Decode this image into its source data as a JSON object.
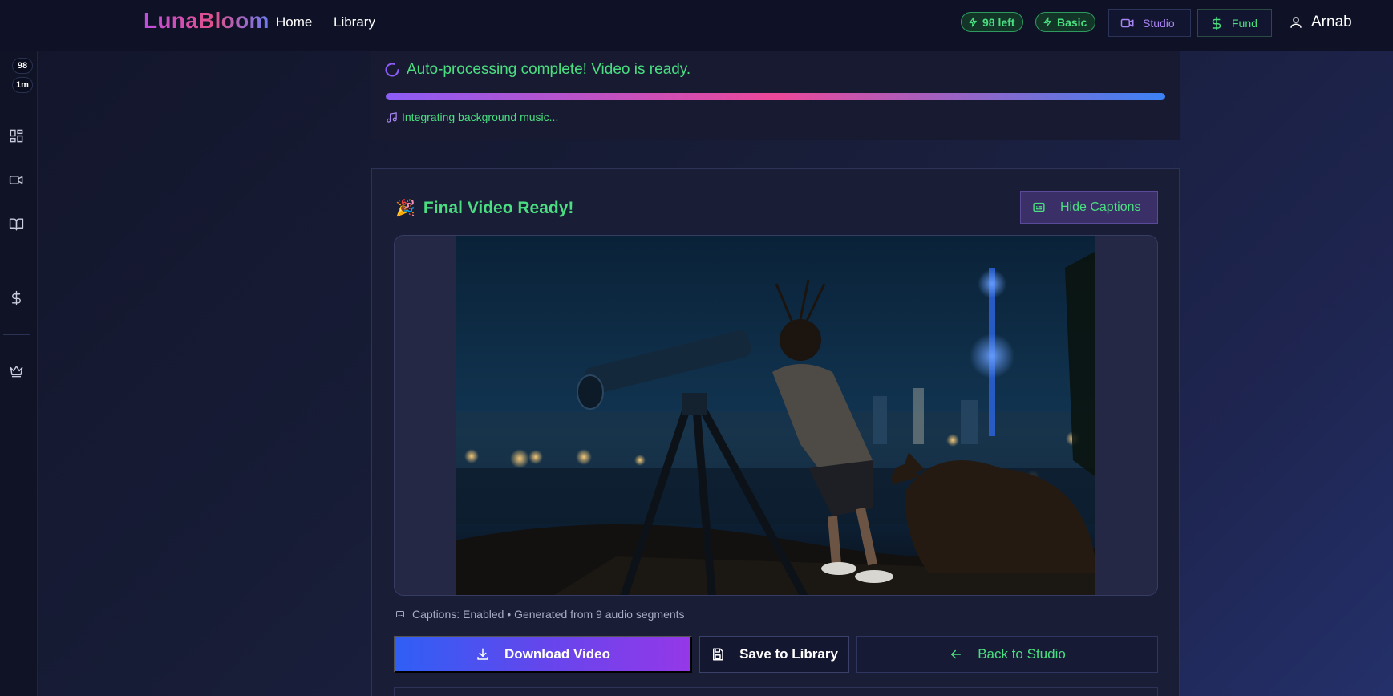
{
  "nav": {
    "brand": "LunaBloom",
    "links": {
      "home": "Home",
      "library": "Library"
    },
    "credits_pill": "98 left",
    "plan_pill": "Basic",
    "studio_button": "Studio",
    "fund_button": "Fund",
    "user_name": "Arnab"
  },
  "sidebar": {
    "credits_badge": "98",
    "time_badge": "1m",
    "icons": [
      "dashboard-icon",
      "video-camera-icon",
      "book-icon",
      "dollar-icon",
      "crown-icon"
    ]
  },
  "progress": {
    "status": "Auto-processing complete! Video is ready.",
    "percent": 100,
    "step": "Integrating background music..."
  },
  "result": {
    "title": "Final Video Ready!",
    "hide_captions": "Hide Captions",
    "caption_info": "Captions: Enabled • Generated from 9 audio segments",
    "actions": {
      "download": "Download Video",
      "save": "Save to Library",
      "back": "Back to Studio"
    }
  },
  "colors": {
    "accent_green": "#4ade80",
    "accent_purple": "#a985f2",
    "gradient_start": "#8b5cf6",
    "gradient_mid": "#ec4899",
    "gradient_end": "#3b82f6"
  }
}
